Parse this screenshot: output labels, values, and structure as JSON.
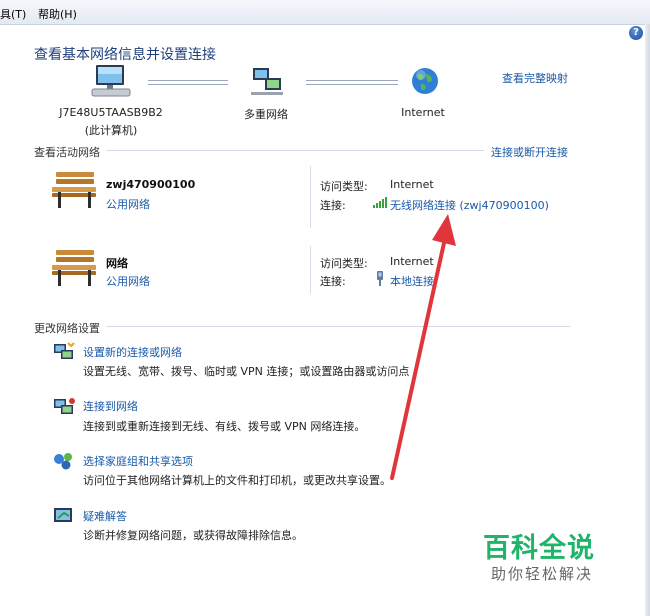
{
  "menu": {
    "tools": "具(T)",
    "help": "帮助(H)"
  },
  "help_icon": "?",
  "page_title": "查看基本网络信息并设置连接",
  "network_map": {
    "computer_name": "J7E48U5TAASB9B2",
    "computer_sub": "(此计算机)",
    "middle_label": "多重网络",
    "internet_label": "Internet",
    "full_map_link": "查看完整映射"
  },
  "active_networks": {
    "section_title": "查看活动网络",
    "connect_link": "连接或断开连接",
    "access_type_label": "访问类型:",
    "connection_label": "连接:",
    "items": [
      {
        "name": "zwj470900100",
        "type": "公用网络",
        "access_type": "Internet",
        "connection": "无线网络连接 (zwj470900100)",
        "connection_icon": "wifi-signal-icon"
      },
      {
        "name": "网络",
        "type": "公用网络",
        "access_type": "Internet",
        "connection": "本地连接",
        "connection_icon": "ethernet-icon"
      }
    ]
  },
  "change_settings": {
    "section_title": "更改网络设置",
    "tasks": [
      {
        "title": "设置新的连接或网络",
        "desc": "设置无线、宽带、拨号、临时或 VPN 连接；或设置路由器或访问点",
        "icon": "new-connection-icon"
      },
      {
        "title": "连接到网络",
        "desc": "连接到或重新连接到无线、有线、拨号或 VPN 网络连接。",
        "icon": "connect-network-icon"
      },
      {
        "title": "选择家庭组和共享选项",
        "desc": "访问位于其他网络计算机上的文件和打印机，或更改共享设置。",
        "icon": "homegroup-icon"
      },
      {
        "title": "疑难解答",
        "desc": "诊断并修复网络问题，或获得故障排除信息。",
        "icon": "troubleshoot-icon"
      }
    ]
  },
  "watermark": {
    "big": "百科全说",
    "small": "助你轻松解决"
  },
  "colors": {
    "link": "#1a5aa8",
    "title": "#1f3f7a",
    "watermark": "#20b36a",
    "arrow": "#e0353a"
  }
}
